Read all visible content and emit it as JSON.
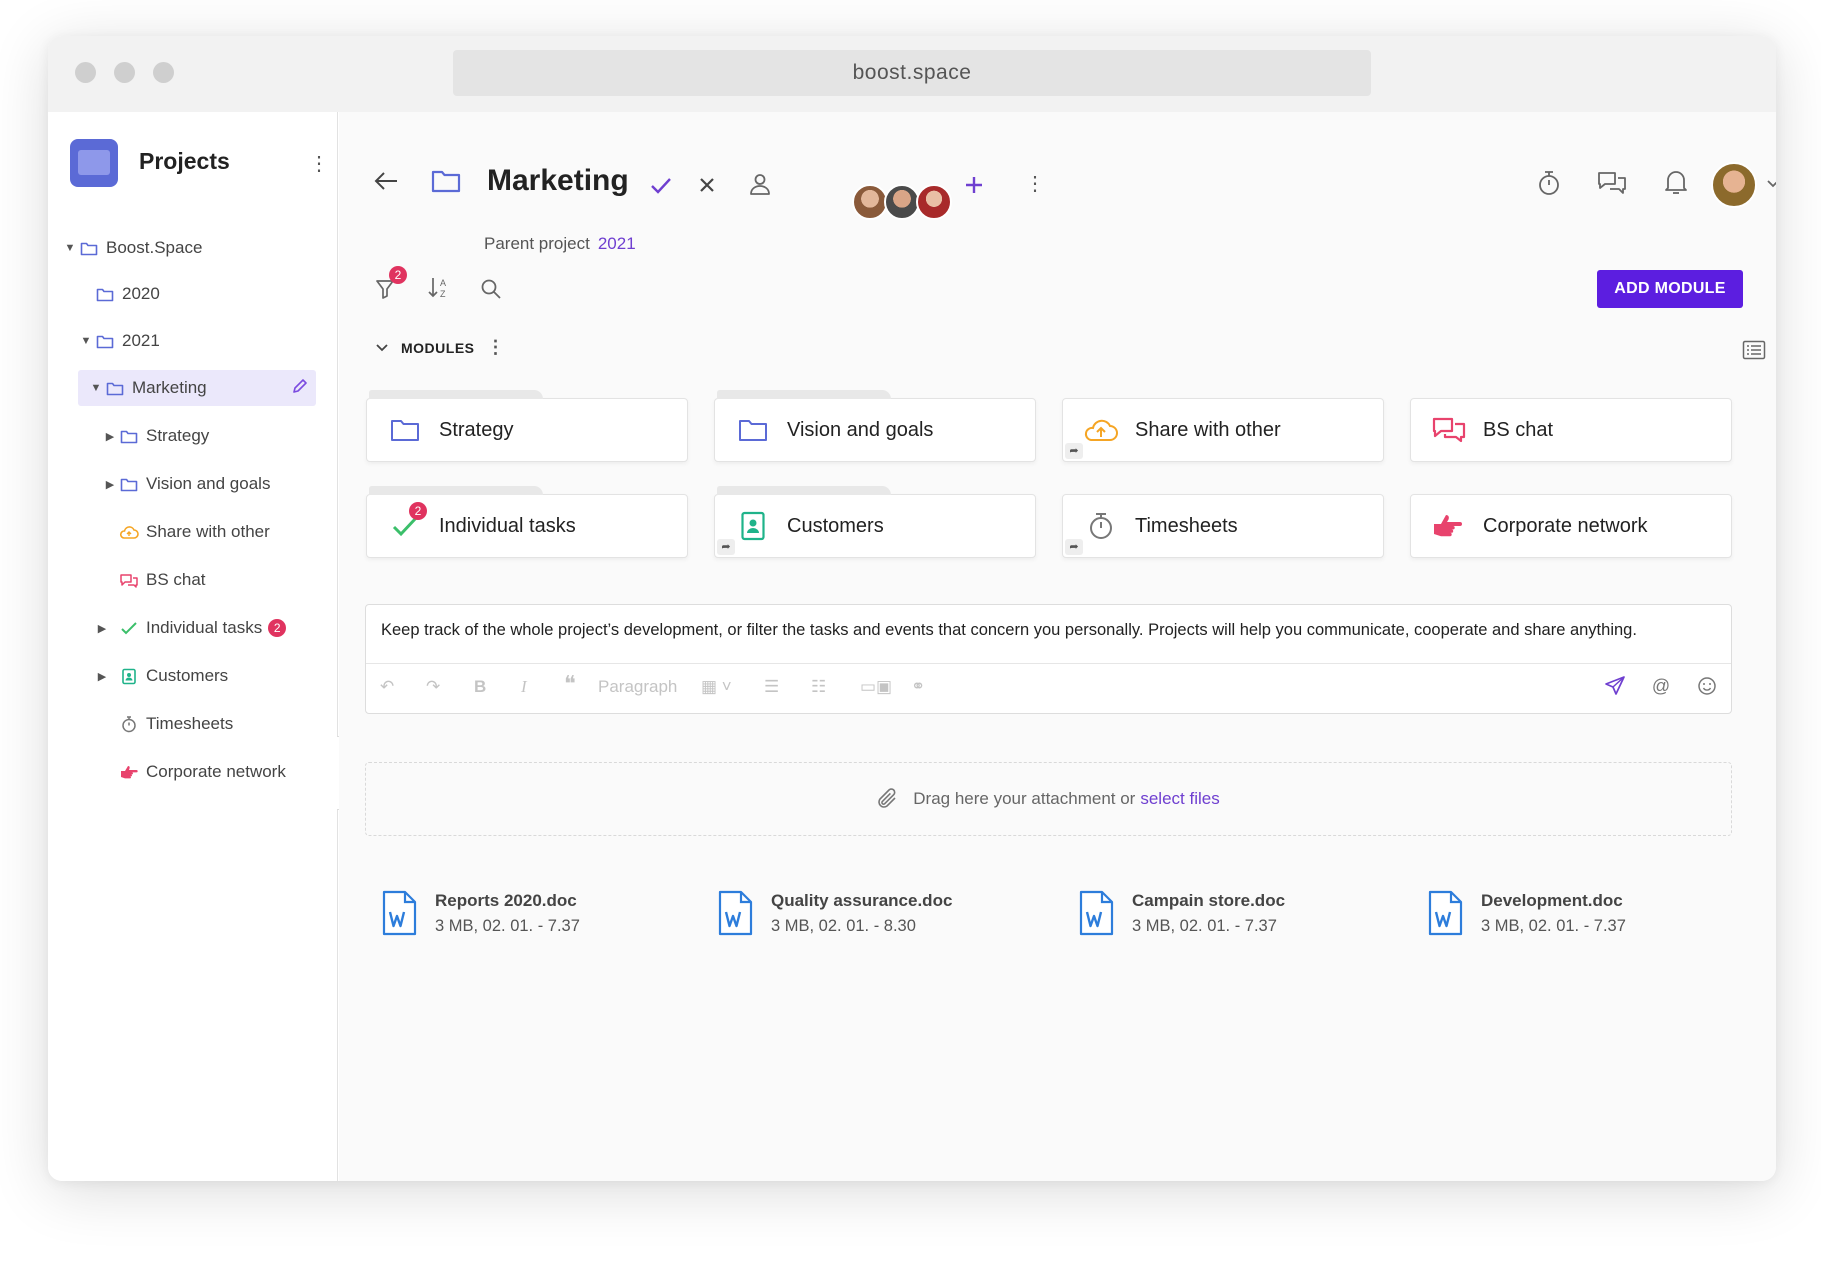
{
  "window": {
    "url": "boost.space"
  },
  "sidebar": {
    "app_title": "Projects",
    "tree": [
      {
        "label": "Boost.Space",
        "icon": "folder-icon",
        "expanded": true
      },
      {
        "label": "2020",
        "icon": "folder-icon"
      },
      {
        "label": "2021",
        "icon": "folder-icon",
        "expanded": true
      },
      {
        "label": "Marketing",
        "icon": "folder-icon",
        "expanded": true,
        "active": true
      },
      {
        "label": "Strategy",
        "icon": "folder-icon"
      },
      {
        "label": "Vision and goals",
        "icon": "folder-icon"
      },
      {
        "label": "Share with other",
        "icon": "cloud-upload-icon"
      },
      {
        "label": "BS chat",
        "icon": "chat-icon"
      },
      {
        "label": "Individual tasks",
        "icon": "check-icon",
        "badge": "2"
      },
      {
        "label": "Customers",
        "icon": "contact-book-icon"
      },
      {
        "label": "Timesheets",
        "icon": "stopwatch-icon"
      },
      {
        "label": "Corporate network",
        "icon": "pointing-hand-icon"
      }
    ]
  },
  "header": {
    "title": "Marketing",
    "parent_label": "Parent project",
    "parent_link": "2021",
    "filter_badge": "2"
  },
  "toolbar": {
    "add_module": "ADD MODULE"
  },
  "modules": {
    "label": "MODULES",
    "cards": [
      {
        "label": "Strategy",
        "icon": "folder-icon"
      },
      {
        "label": "Vision and goals",
        "icon": "folder-icon"
      },
      {
        "label": "Share with other",
        "icon": "cloud-upload-icon"
      },
      {
        "label": "BS chat",
        "icon": "chat-icon"
      },
      {
        "label": "Individual tasks",
        "icon": "check-icon",
        "badge": "2"
      },
      {
        "label": "Customers",
        "icon": "contact-book-icon"
      },
      {
        "label": "Timesheets",
        "icon": "stopwatch-icon"
      },
      {
        "label": "Corporate network",
        "icon": "pointing-hand-icon"
      }
    ]
  },
  "editor": {
    "text": "Keep track of the whole project’s development, or filter the tasks and events that concern you personally. Projects will help you communicate, cooperate and share anything.",
    "paragraph_label": "Paragraph"
  },
  "attachments": {
    "drop_text": "Drag here your attachment or",
    "select_files": "select files",
    "files": [
      {
        "name": "Reports 2020.doc",
        "meta": "3 MB, 02. 01. - 7.37"
      },
      {
        "name": "Quality assurance.doc",
        "meta": "3 MB, 02. 01. - 8.30"
      },
      {
        "name": "Campain store.doc",
        "meta": "3 MB, 02. 01. - 7.37"
      },
      {
        "name": "Development.doc",
        "meta": "3 MB, 02. 01. - 7.37"
      }
    ]
  },
  "colors": {
    "accent": "#5c1ee0",
    "link": "#6f3fd0",
    "badge": "#e0335f",
    "active_bg": "#ebe8fb"
  }
}
